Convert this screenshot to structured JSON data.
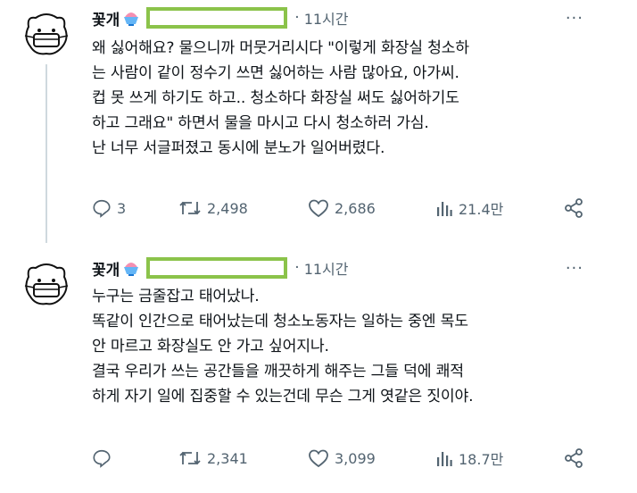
{
  "tweets": [
    {
      "name": "꽃개",
      "time": "11시간",
      "more": "···",
      "lines": [
        "왜 싫어해요? 물으니까 머뭇거리시다 \"이렇게 화장실 청소하",
        "는 사람이 같이 정수기 쓰면 싫어하는 사람 많아요, 아가씨.",
        "컵 못 쓰게 하기도 하고.. 청소하다 화장실 써도 싫어하기도",
        "하고 그래요\" 하면서 물을 마시고 다시 청소하러 가심.",
        "난 너무 서글퍼졌고 동시에 분노가 일어버렸다."
      ],
      "replies": "3",
      "retweets": "2,498",
      "likes": "2,686",
      "views": "21.4만"
    },
    {
      "name": "꽃개",
      "time": "11시간",
      "more": "···",
      "lines": [
        "누구는 금줄잡고 태어났나.",
        "똑같이 인간으로 태어났는데 청소노동자는 일하는 중엔 목도",
        "안 마르고 화장실도 안 가고 싶어지나.",
        "결국 우리가 쓰는 공간들을 깨끗하게 해주는 그들 덕에 쾌적",
        "하게 자기 일에 집중할 수 있는건데 무슨 그게 엿같은 짓이야."
      ],
      "replies": "",
      "retweets": "2,341",
      "likes": "3,099",
      "views": "18.7만"
    }
  ],
  "icons": {
    "avatar": "bear-avatar-icon",
    "emoji": "shaved-ice-emoji-icon",
    "reply": "reply-icon",
    "retweet": "retweet-icon",
    "like": "heart-icon",
    "views": "views-chart-icon",
    "share": "share-icon"
  },
  "colors": {
    "text": "#0f1419",
    "secondary": "#536471",
    "redaction_border": "#8bc34a",
    "thread_line": "#cfd9de"
  }
}
